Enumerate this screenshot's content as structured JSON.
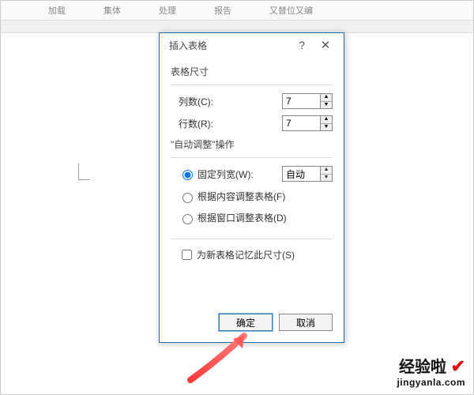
{
  "topbar": [
    "加载",
    "集体",
    "处理",
    "报告",
    "又替位又编"
  ],
  "dialog": {
    "title": "插入表格",
    "size_group": "表格尺寸",
    "cols_label": "列数(C):",
    "cols_value": "7",
    "rows_label": "行数(R):",
    "rows_value": "7",
    "auto_group": "\"自动调整\"操作",
    "r_fixed": "固定列宽(W):",
    "fixed_value": "自动",
    "r_content": "根据内容调整表格(F)",
    "r_window": "根据窗口调整表格(D)",
    "remember": "为新表格记忆此尺寸(S)",
    "ok": "确定",
    "cancel": "取消"
  },
  "watermark": {
    "name": "经验啦",
    "url": "jingyanla.com"
  }
}
